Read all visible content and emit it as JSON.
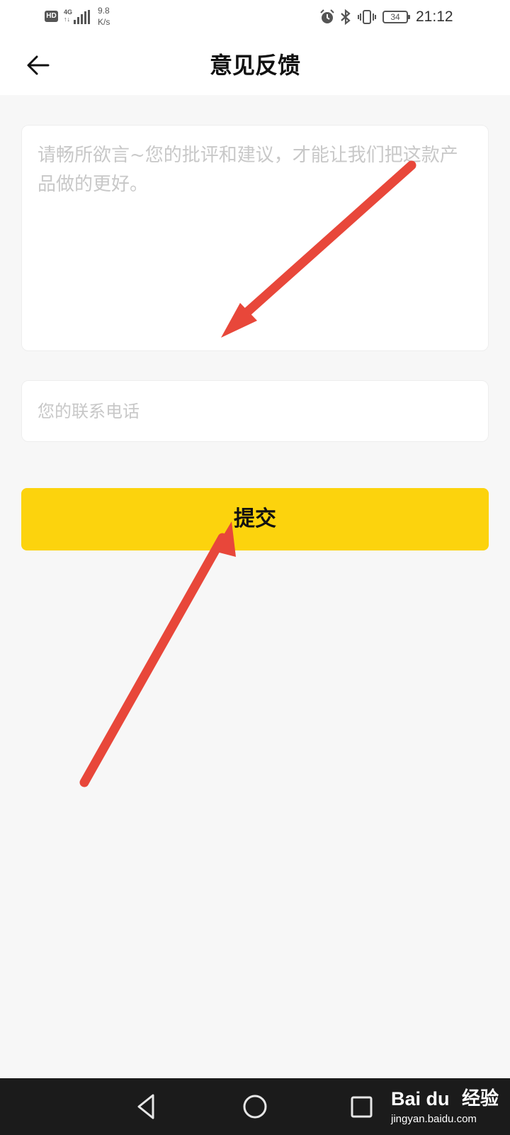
{
  "status_bar": {
    "hd_badge": "HD",
    "network_type": "4G",
    "network_sub": "↑↓",
    "speed_value": "9.8",
    "speed_unit": "K/s",
    "battery": "34",
    "time": "21:12"
  },
  "header": {
    "title": "意见反馈",
    "back_icon": "arrow-left-icon"
  },
  "form": {
    "feedback_placeholder": "请畅所欲言~您的批评和建议，才能让我们把这款产品做的更好。",
    "feedback_value": "",
    "phone_placeholder": "您的联系电话",
    "phone_value": "",
    "submit_label": "提交"
  },
  "nav_bar": {
    "icons": [
      "back-triangle-icon",
      "home-circle-icon",
      "recents-square-icon"
    ]
  },
  "watermark": {
    "logo": "Bai du",
    "text": "经验",
    "url": "jingyan.baidu.com"
  },
  "colors": {
    "accent": "#fcd30d",
    "annotation_arrow": "#e8473a",
    "background": "#f7f7f7",
    "placeholder": "#c8c8c8"
  }
}
